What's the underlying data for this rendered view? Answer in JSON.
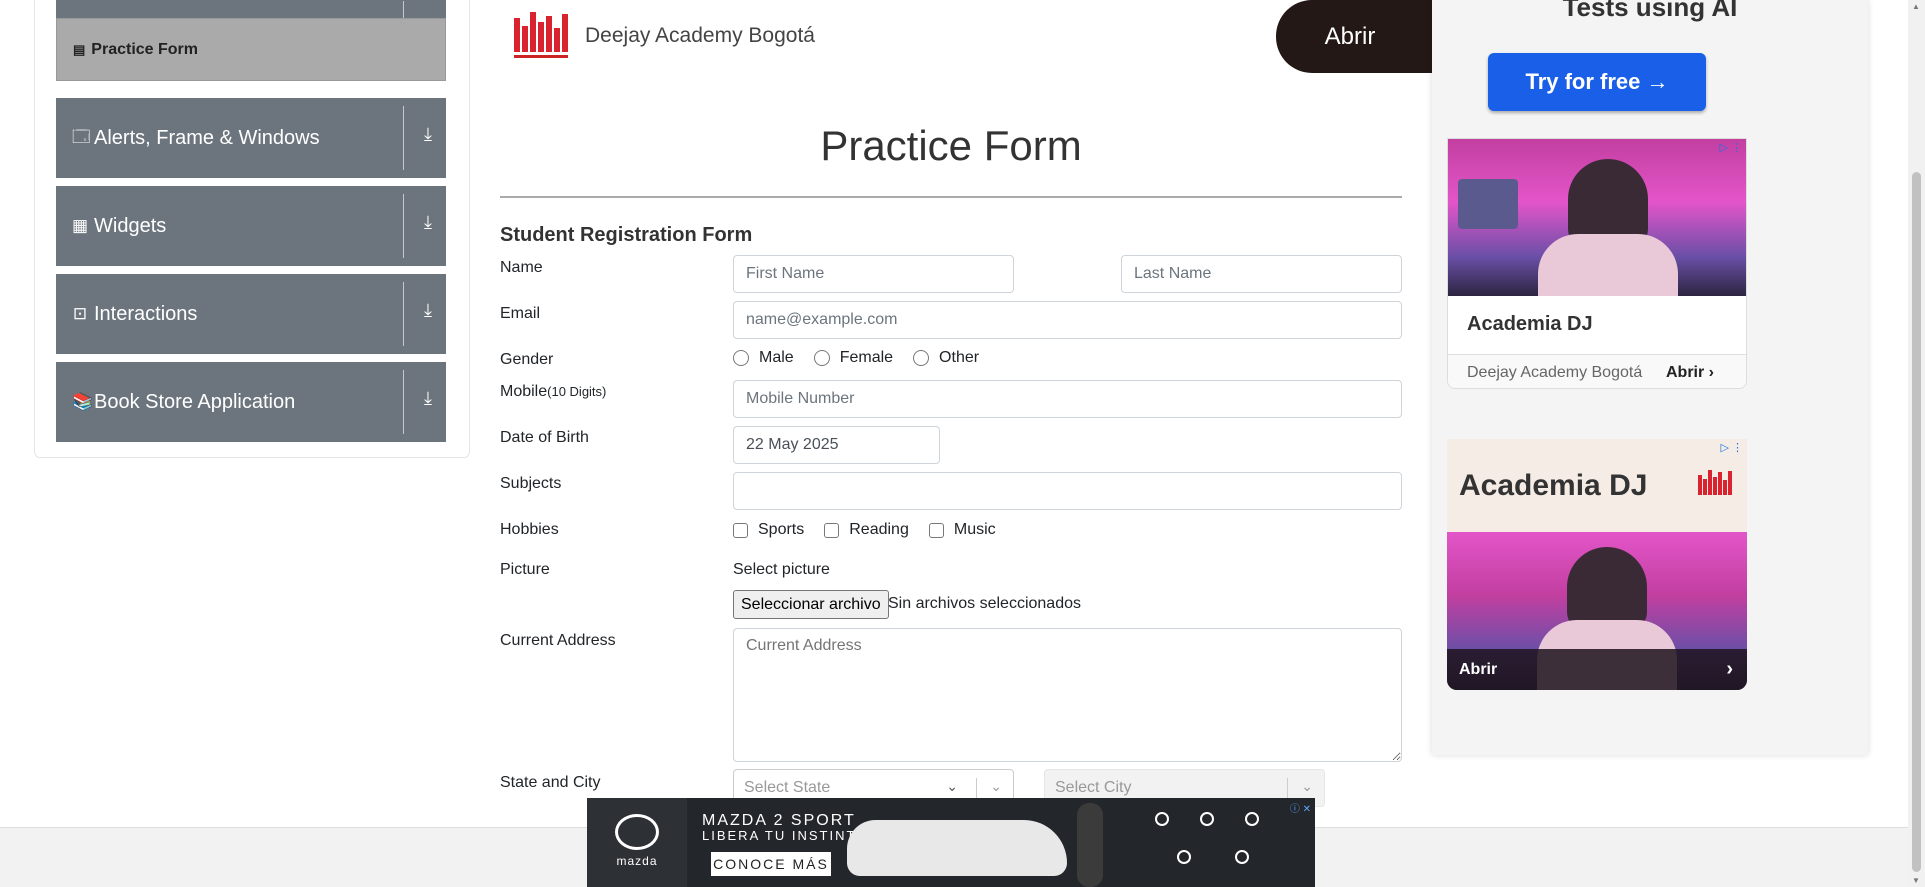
{
  "sidebar": {
    "active_item": "Practice Form",
    "groups": [
      {
        "label": "Alerts, Frame & Windows",
        "icon": "window-icon"
      },
      {
        "label": "Widgets",
        "icon": "widgets-icon"
      },
      {
        "label": "Interactions",
        "icon": "interactions-icon"
      },
      {
        "label": "Book Store Application",
        "icon": "books-icon"
      }
    ]
  },
  "header_ad": {
    "brand": "Deejay Academy Bogotá",
    "button": "Abrir"
  },
  "form": {
    "title": "Practice Form",
    "subtitle": "Student Registration Form",
    "labels": {
      "name": "Name",
      "email": "Email",
      "gender": "Gender",
      "mobile": "Mobile",
      "mobile_hint": "(10 Digits)",
      "dob": "Date of Birth",
      "subjects": "Subjects",
      "hobbies": "Hobbies",
      "picture": "Picture",
      "address": "Current Address",
      "state_city": "State and City"
    },
    "placeholders": {
      "first_name": "First Name",
      "last_name": "Last Name",
      "email": "name@example.com",
      "mobile": "Mobile Number",
      "address": "Current Address",
      "state": "Select State",
      "city": "Select City"
    },
    "values": {
      "dob": "22 May 2025"
    },
    "gender_options": [
      "Male",
      "Female",
      "Other"
    ],
    "hobby_options": [
      "Sports",
      "Reading",
      "Music"
    ],
    "picture_hint": "Select picture",
    "file_button": "Seleccionar archivo",
    "file_status": "Sin archivos seleccionados"
  },
  "right_ads": {
    "top_heading": "Tests using AI",
    "try_button": "Try for free →",
    "card1_title": "Academia DJ",
    "card1_brand": "Deejay Academy Bogotá",
    "card1_cta": "Abrir",
    "card2_title": "Academia DJ",
    "card2_cta": "Abrir"
  },
  "bottom_ad": {
    "line1": "MAZDA 2 SPORT",
    "line2": "LIBERA TU INSTINTO",
    "cta": "CONOCE MÁS",
    "brand": "mazda"
  },
  "colors": {
    "sidebar_group": "#6c757d",
    "sidebar_active": "#aaaaaa",
    "try_button": "#1a5fe8",
    "abrir_pill": "#231815"
  }
}
